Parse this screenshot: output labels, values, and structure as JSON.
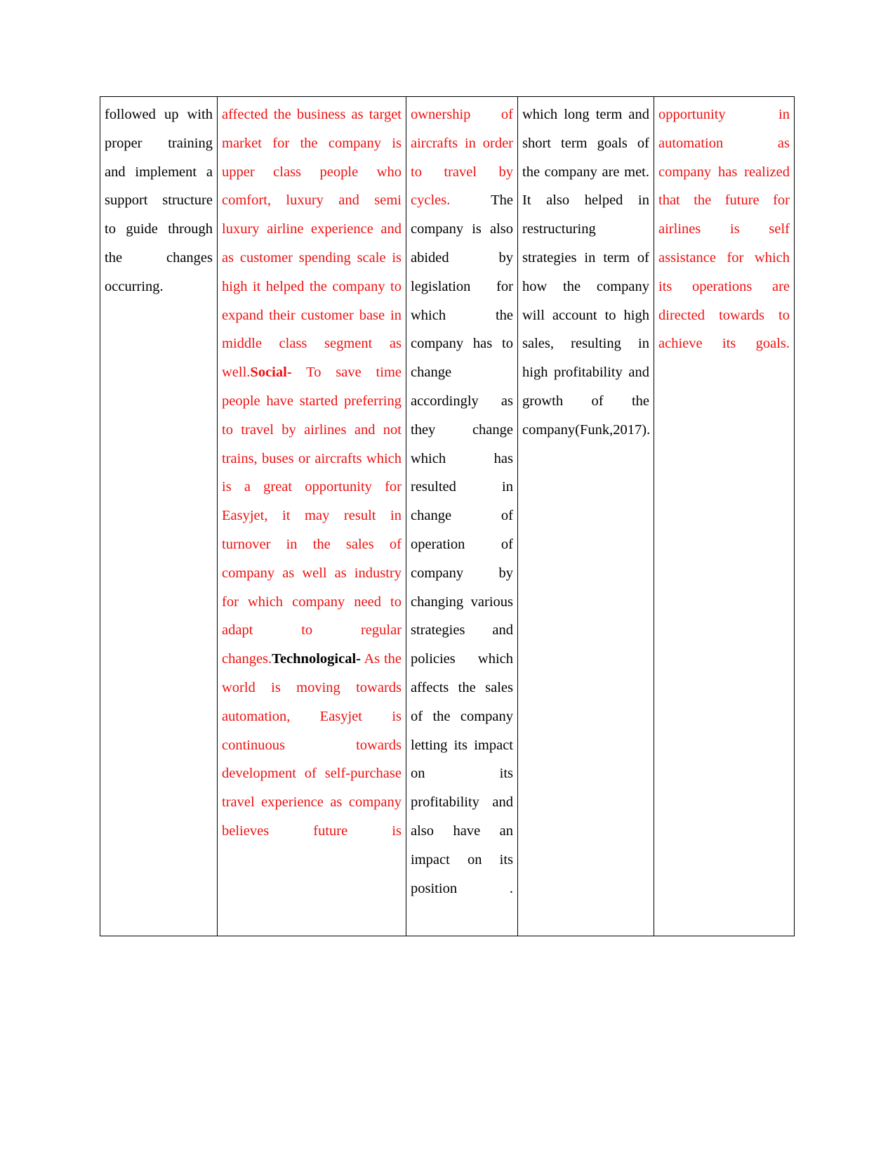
{
  "document": {
    "type": "table",
    "columns": 5,
    "rows": 1,
    "colors": {
      "highlight_red": "#ee1111",
      "body_black": "#000000",
      "border": "#000000",
      "page_background": "#ffffff"
    }
  },
  "table": {
    "column1": {
      "segments": [
        {
          "text": "followed up with proper training and implement a support structure to guide through the changes occurring.",
          "color": "black",
          "bold": false
        }
      ]
    },
    "column2": {
      "segments": [
        {
          "text": "affected the business as target market for the company is upper class people who comfort, luxury and semi luxury airline experience and as customer spending scale is high it helped the company to expand their customer base in middle class segment as well.",
          "color": "red",
          "bold": false
        },
        {
          "text": "Social-",
          "color": "red",
          "bold": true
        },
        {
          "text": " To save time people have started preferring to travel by airlines and not trains, buses or aircrafts which is a great opportunity for Easyjet, it may result in turnover in the sales of company as well as industry for which company need to adapt to regular changes.",
          "color": "red",
          "bold": false
        },
        {
          "text": "Technological-",
          "color": "black",
          "bold": true
        },
        {
          "text": " As the world is moving towards automation, Easyjet is continuous towards development of self-purchase travel experience as company believes future is",
          "color": "red",
          "bold": false
        }
      ]
    },
    "column3": {
      "segments": [
        {
          "text": "ownership of aircrafts in order to travel by cycles.",
          "color": "red",
          "bold": false
        },
        {
          "text": " The company is also abided by legislation for which the company has to change accordingly as they change which has resulted in change of operation of company by changing various strategies and policies which affects the sales of the company letting its impact on its profitability and also have an impact on its position .",
          "color": "black",
          "bold": false
        }
      ]
    },
    "column4": {
      "segments": [
        {
          "text": "which long term and short term goals of the company are met. It also helped in restructuring strategies in term of how the company will account to high sales, resulting in high profitability and growth of the company",
          "color": "black",
          "bold": false
        },
        {
          "text": "(Funk,2017).",
          "color": "black",
          "bold": false
        }
      ]
    },
    "column5": {
      "segments": [
        {
          "text": "opportunity in automation as company has realized that the future for airlines is self assistance for which its operations are directed towards to achieve its goals.",
          "color": "red",
          "bold": false
        }
      ]
    }
  }
}
